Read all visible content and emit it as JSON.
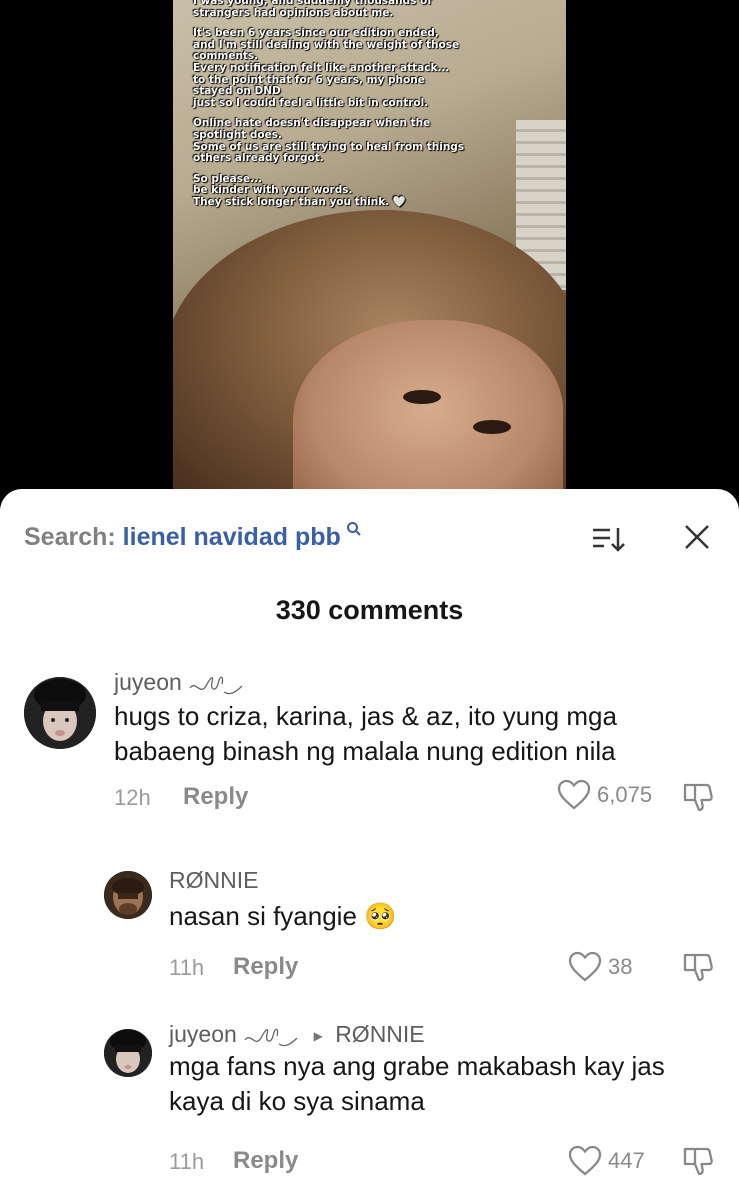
{
  "video": {
    "overlay_lines": [
      "I was young, and suddenly thousands of\nstrangers had opinions about me.",
      "It's been 6 years since our edition ended,\nand I'm still dealing with the weight of those\ncomments.\nEvery notification felt like another attack...\nto the point that for 6 years, my phone\nstayed on DND\njust so I could feel a little bit in control.",
      "Online hate doesn't disappear when the\nspotlight does.\nSome of us are still trying to heal from things\nothers already forgot.",
      "So please...\nbe kinder with your words.\nThey stick longer than you think. 🤍"
    ]
  },
  "search": {
    "label": "Search:",
    "query": "lienel navidad pbb",
    "icon": "search-icon"
  },
  "header": {
    "comment_count": "330 comments",
    "sort_icon": "sort-icon",
    "close_icon": "close-icon"
  },
  "comments": [
    {
      "username": "juyeon",
      "text_line1": "hugs to criza, karina, jas & az, ito yung mga",
      "text_line2": "babaeng binash ng malala nung edition nila",
      "time": "12h",
      "reply_label": "Reply",
      "likes": "6,075"
    },
    {
      "username": "RØNNIE",
      "text_line1": "nasan si fyangie 🥺",
      "time": "11h",
      "reply_label": "Reply",
      "likes": "38"
    },
    {
      "username": "juyeon",
      "reply_to": "RØNNIE",
      "text_line1": "mga fans nya ang grabe makabash kay jas",
      "text_line2": "kaya di ko sya sinama",
      "time": "11h",
      "reply_label": "Reply",
      "likes": "447"
    }
  ],
  "colors": {
    "accent": "#3b5fa6",
    "text": "#161616",
    "muted": "#8a8a8a"
  }
}
